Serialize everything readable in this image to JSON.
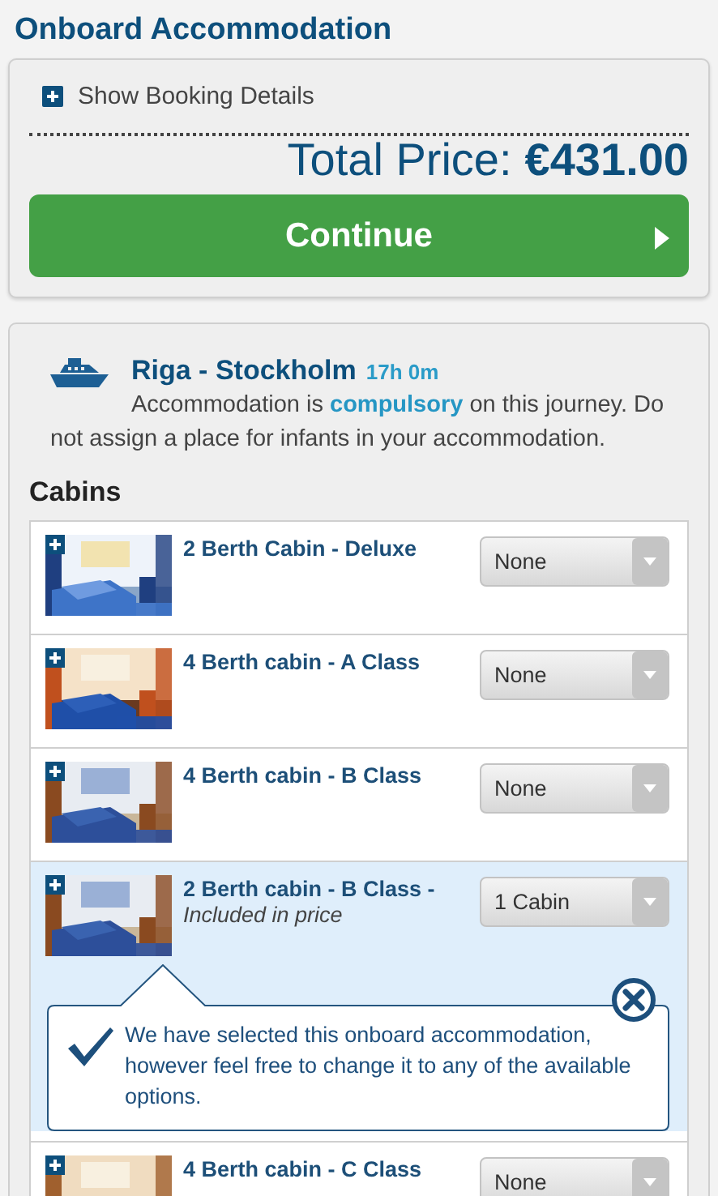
{
  "page_title": "Onboard Accommodation",
  "booking_details": {
    "label": "Show Booking Details",
    "expanded": false
  },
  "total": {
    "label": "Total Price:",
    "amount": "€431.00"
  },
  "continue_button": {
    "label": "Continue"
  },
  "journey": {
    "route": "Riga - Stockholm",
    "duration": "17h 0m",
    "notice": "Accommodation is **compulsory** on this journey. Do not assign a place for infants in your accommodation."
  },
  "cabins_heading": "Cabins",
  "cabins": [
    {
      "name": "2 Berth Cabin - Deluxe",
      "quantity": "None",
      "selected": false
    },
    {
      "name": "4 Berth cabin - A Class",
      "quantity": "None",
      "selected": false
    },
    {
      "name": "4 Berth cabin - B Class",
      "quantity": "None",
      "selected": false
    },
    {
      "name": "2 Berth cabin - B Class -",
      "note": "Included in price",
      "quantity": "1 Cabin",
      "selected": true,
      "message": "We have selected this onboard accommodation, however feel free to change it to any of the available options."
    },
    {
      "name": "4 Berth cabin - C Class",
      "quantity": "None",
      "selected": false
    }
  ]
}
